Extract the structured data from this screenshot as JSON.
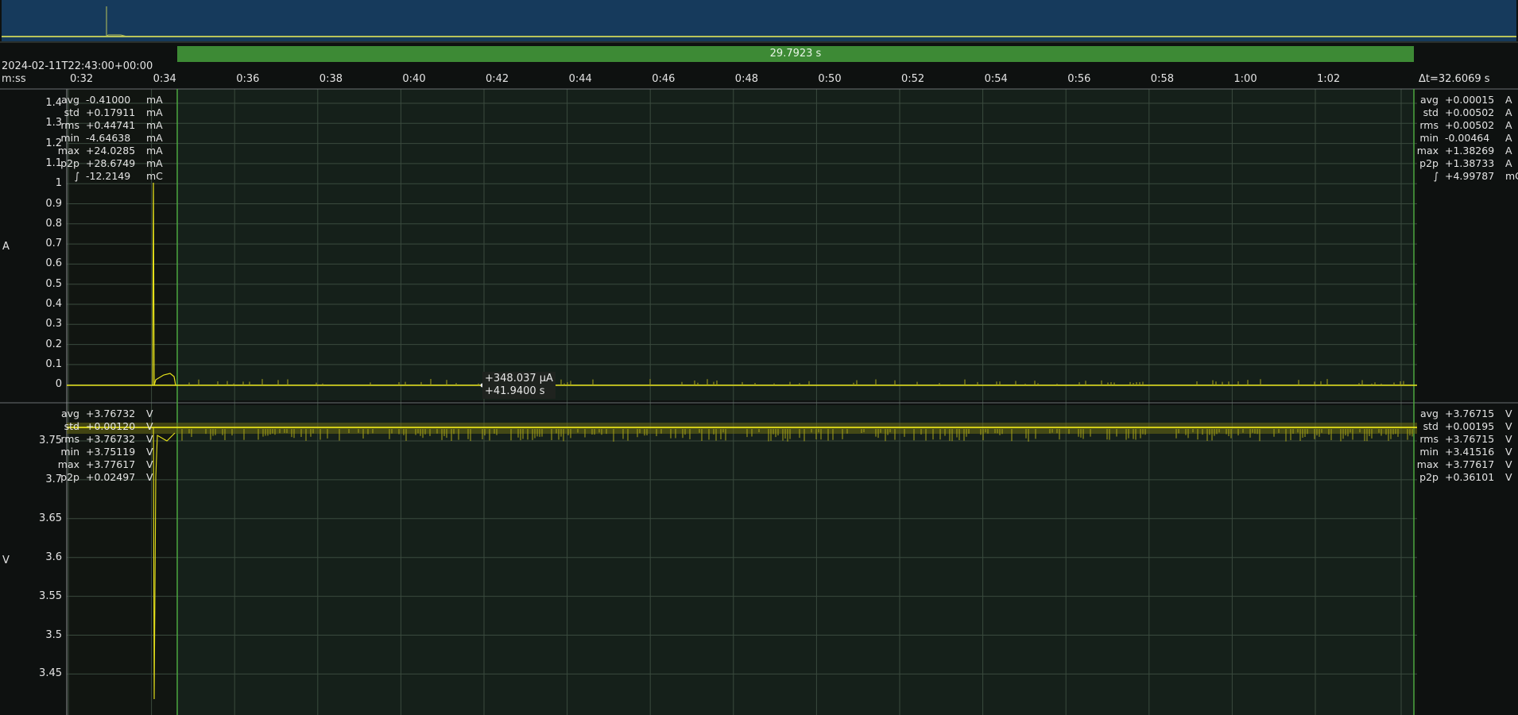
{
  "overview": {
    "bg_color": "#163a5c",
    "trace_color": "#b9c45a"
  },
  "header": {
    "timestamp": "2024-02-11T22:43:00+00:00",
    "time_format": "m:ss",
    "selection_duration": "29.7923 s",
    "delta_t": "Δt=32.6069 s",
    "x_ticks": [
      "0:32",
      "0:34",
      "0:36",
      "0:38",
      "0:40",
      "0:42",
      "0:44",
      "0:46",
      "0:48",
      "0:50",
      "0:52",
      "0:54",
      "0:56",
      "0:58",
      "1:00",
      "1:02"
    ]
  },
  "current_plot": {
    "axis_name": "A",
    "y_ticks": [
      "1.4",
      "1.3",
      "1.2",
      "1.1",
      "1",
      "0.9",
      "0.8",
      "0.7",
      "0.6",
      "0.5",
      "0.4",
      "0.3",
      "0.2",
      "0.1",
      "0"
    ],
    "stats_left": [
      {
        "label": "avg",
        "value": "-0.41000",
        "unit": "mA"
      },
      {
        "label": "std",
        "value": "+0.17911",
        "unit": "mA"
      },
      {
        "label": "rms",
        "value": "+0.44741",
        "unit": "mA"
      },
      {
        "label": "min",
        "value": "-4.64638",
        "unit": "mA"
      },
      {
        "label": "max",
        "value": "+24.0285",
        "unit": "mA"
      },
      {
        "label": "p2p",
        "value": "+28.6749",
        "unit": "mA"
      },
      {
        "label": "∫",
        "value": "-12.2149",
        "unit": "mC"
      }
    ],
    "stats_right": [
      {
        "label": "avg",
        "value": "+0.00015",
        "unit": "A"
      },
      {
        "label": "std",
        "value": "+0.00502",
        "unit": "A"
      },
      {
        "label": "rms",
        "value": "+0.00502",
        "unit": "A"
      },
      {
        "label": "min",
        "value": "-0.00464",
        "unit": "A"
      },
      {
        "label": "max",
        "value": "+1.38269",
        "unit": "A"
      },
      {
        "label": "p2p",
        "value": "+1.38733",
        "unit": "A"
      },
      {
        "label": "∫",
        "value": "+4.99787",
        "unit": "mC"
      }
    ],
    "cursor": {
      "value": "+348.037 µA",
      "time": "+41.9400 s"
    }
  },
  "voltage_plot": {
    "axis_name": "V",
    "y_ticks": [
      "3.75",
      "3.7",
      "3.65",
      "3.6",
      "3.55",
      "3.5",
      "3.45"
    ],
    "stats_left": [
      {
        "label": "avg",
        "value": "+3.76732",
        "unit": "V"
      },
      {
        "label": "std",
        "value": "+0.00120",
        "unit": "V"
      },
      {
        "label": "rms",
        "value": "+3.76732",
        "unit": "V"
      },
      {
        "label": "min",
        "value": "+3.75119",
        "unit": "V"
      },
      {
        "label": "max",
        "value": "+3.77617",
        "unit": "V"
      },
      {
        "label": "p2p",
        "value": "+0.02497",
        "unit": "V"
      }
    ],
    "stats_right": [
      {
        "label": "avg",
        "value": "+3.76715",
        "unit": "V"
      },
      {
        "label": "std",
        "value": "+0.00195",
        "unit": "V"
      },
      {
        "label": "rms",
        "value": "+3.76715",
        "unit": "V"
      },
      {
        "label": "min",
        "value": "+3.41516",
        "unit": "V"
      },
      {
        "label": "max",
        "value": "+3.77617",
        "unit": "V"
      },
      {
        "label": "p2p",
        "value": "+0.36101",
        "unit": "V"
      }
    ]
  },
  "colors": {
    "trace": "#e6e21a",
    "selection": "#3d8a35",
    "plot_bg": "#15201a",
    "grid": "#3a4a3e"
  }
}
